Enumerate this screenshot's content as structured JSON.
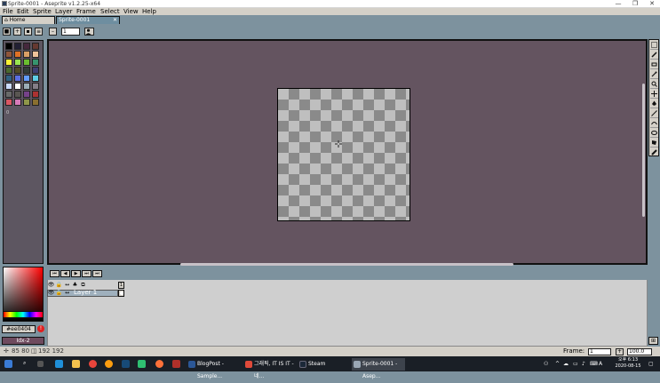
{
  "window": {
    "title": "Sprite-0001 - Aseprite v1.2.25-x64",
    "controls": [
      "—",
      "❐",
      "✕"
    ]
  },
  "menu": [
    "File",
    "Edit",
    "Sprite",
    "Layer",
    "Frame",
    "Select",
    "View",
    "Help"
  ],
  "tabs": [
    {
      "label": "Home",
      "icon": "home-icon"
    },
    {
      "label": "Sprite-0001",
      "close": "✕"
    }
  ],
  "toolbar": {
    "frame_value": "1"
  },
  "palette": {
    "colors": [
      "#000000",
      "#222034",
      "#45283c",
      "#663931",
      "#8f563b",
      "#df7126",
      "#d9a066",
      "#eec39a",
      "#fbf236",
      "#99e550",
      "#6abe30",
      "#37946e",
      "#4b692f",
      "#524b24",
      "#323c39",
      "#3f3f74",
      "#306082",
      "#5b6ee1",
      "#639bff",
      "#5fcde4",
      "#cbdbfc",
      "#ffffff",
      "#9badb7",
      "#847e87",
      "#696a6a",
      "#595652",
      "#76428a",
      "#ac3232",
      "#d95763",
      "#d77bba",
      "#8f974a",
      "#8a6f30"
    ],
    "index_label": "0"
  },
  "color_bar": {
    "fg_label": "#ee0404",
    "warn_label": "!",
    "bg_label": "Idx-2"
  },
  "timeline": {
    "playback": [
      "⏮",
      "◀",
      "▶",
      "⏭",
      "⏭"
    ],
    "frame_header": "1",
    "layer_name": "Layer 1"
  },
  "status": {
    "position": "85 80",
    "size": "192 192",
    "frame_label": "Frame:",
    "frame_value": "1",
    "zoom_value": "100.0"
  },
  "taskbar": {
    "apps": [
      {
        "label": "BlogPost - Sample...",
        "color": "#2b5797"
      },
      {
        "label": "그래픽, IT IS IT - 네...",
        "color": "#e04a3a"
      },
      {
        "label": "Steam",
        "color": "#1b2838"
      },
      {
        "label": "Sprite-0001 - Asep...",
        "color": "#9aa7b5"
      }
    ],
    "time": "오후 6:13",
    "date": "2020-08-15"
  },
  "colors": {
    "editor_bg": "#645460",
    "workspace": "#7d929e",
    "accent": "#ee0404"
  }
}
